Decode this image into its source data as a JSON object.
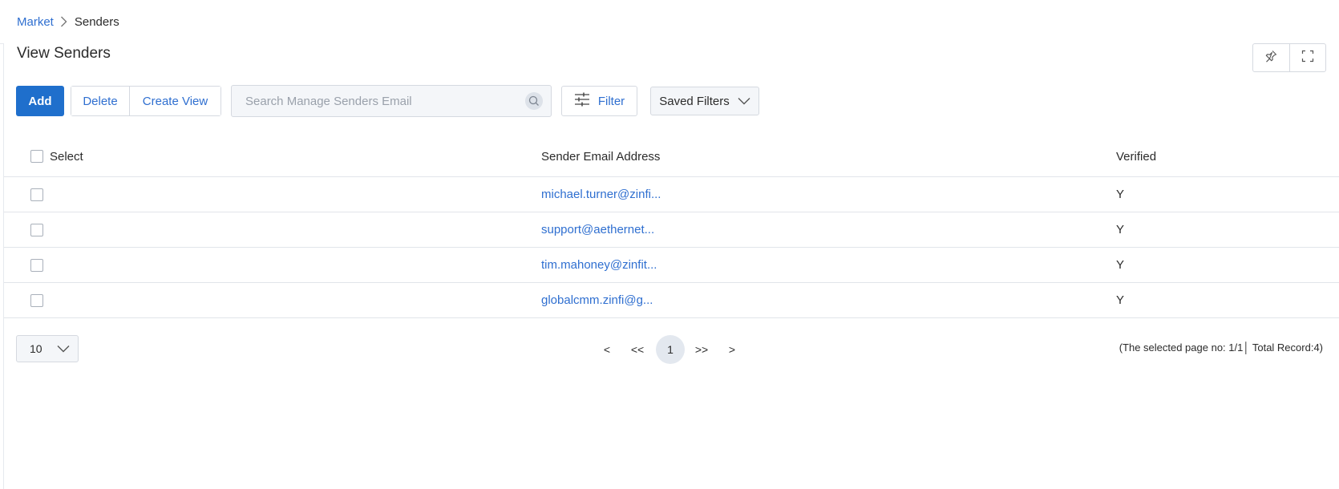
{
  "breadcrumb": {
    "parent": "Market",
    "current": "Senders"
  },
  "page_title": "View Senders",
  "toolbar": {
    "add_label": "Add",
    "delete_label": "Delete",
    "create_view_label": "Create View",
    "search_placeholder": "Search Manage Senders Email",
    "filter_label": "Filter",
    "saved_filters_label": "Saved Filters"
  },
  "header_tools": {
    "pin_icon": "pin-icon",
    "fullscreen_icon": "fullscreen-icon"
  },
  "table": {
    "columns": [
      "Select",
      "Sender Email Address",
      "Verified"
    ],
    "rows": [
      {
        "email": "michael.turner@zinfi...",
        "verified": "Y"
      },
      {
        "email": "support@aethernet...",
        "verified": "Y"
      },
      {
        "email": "tim.mahoney@zinfit...",
        "verified": "Y"
      },
      {
        "email": "globalcmm.zinfi@g...",
        "verified": "Y"
      }
    ]
  },
  "pagination": {
    "page_size": "10",
    "prev": "<",
    "first": "<<",
    "current_page": "1",
    "last": ">>",
    "next": ">",
    "record_info": "(The selected page no: 1/1│ Total Record:4)"
  },
  "colors": {
    "primary": "#1f6fcc",
    "link": "#2f6fd0",
    "border": "#d5d9e0",
    "muted_bg": "#f4f6f9"
  }
}
